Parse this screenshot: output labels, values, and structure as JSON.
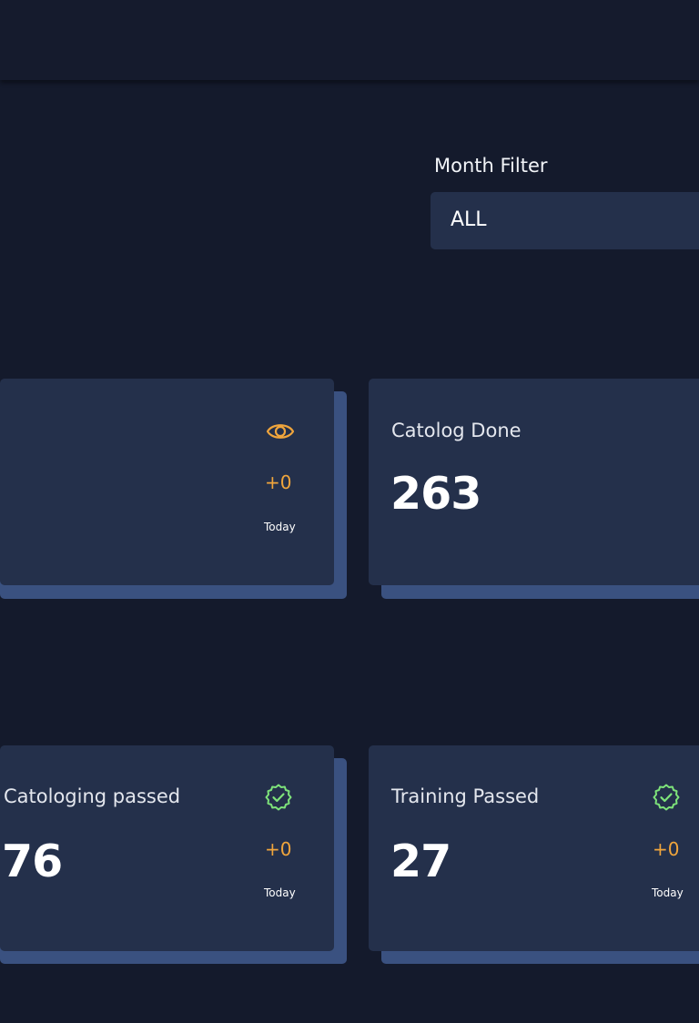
{
  "filter": {
    "label": "Month Filter",
    "selected": "ALL"
  },
  "cards": [
    {
      "title": "",
      "value": "",
      "icon": "eye-icon",
      "delta": "+0",
      "period": "Today"
    },
    {
      "title": "Catolog Done",
      "value": "263"
    },
    {
      "title": "Catologing passed",
      "value": "76",
      "icon": "verified-badge-icon",
      "delta": "+0",
      "period": "Today"
    },
    {
      "title": "Training Passed",
      "value": "27",
      "icon": "verified-badge-icon",
      "delta": "+0",
      "period": "Today"
    }
  ],
  "colors": {
    "background": "#141a2c",
    "card": "#24304b",
    "card_shadow": "#3a5180",
    "accent_orange": "#f0a53c",
    "accent_green": "#7ee37a"
  }
}
